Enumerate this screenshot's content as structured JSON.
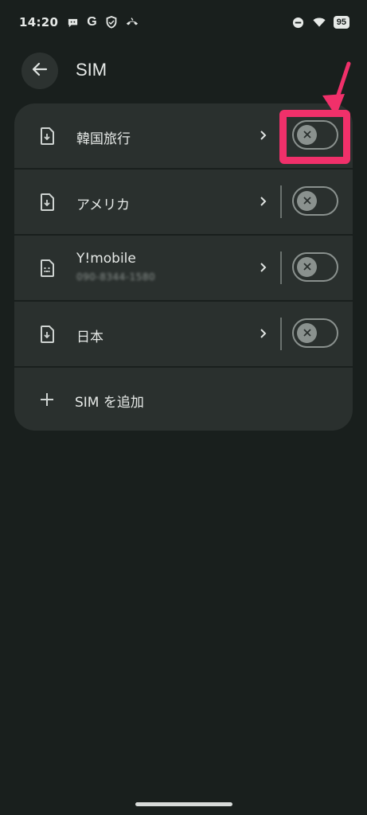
{
  "status_bar": {
    "time": "14:20",
    "google_letter": "G",
    "battery": "95",
    "left_icons": [
      "chat-bubble-icon",
      "google-icon",
      "shield-icon",
      "phone-hangup-icon"
    ],
    "right_icons": [
      "do-not-disturb-icon",
      "wifi-icon",
      "battery-icon"
    ]
  },
  "header": {
    "title": "SIM",
    "back_icon": "arrow-left-icon"
  },
  "sim_list": {
    "items": [
      {
        "label": "韓国旅行",
        "subtitle": "",
        "icon": "esim-download-icon",
        "enabled": false
      },
      {
        "label": "アメリカ",
        "subtitle": "",
        "icon": "esim-download-icon",
        "enabled": false
      },
      {
        "label": "Y!mobile",
        "subtitle": "090-8344-1580",
        "icon": "sim-card-icon",
        "enabled": false
      },
      {
        "label": "日本",
        "subtitle": "",
        "icon": "esim-download-icon",
        "enabled": false
      }
    ],
    "add_label": "SIM を追加"
  },
  "colors": {
    "background": "#191f1d",
    "card": "#2a302e",
    "annotation": "#f0306a"
  }
}
